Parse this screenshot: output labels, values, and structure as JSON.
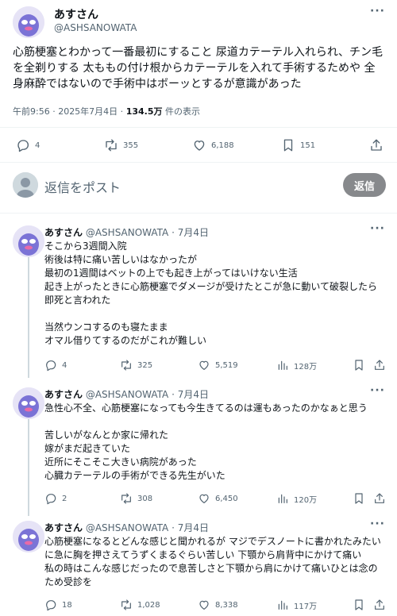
{
  "main_post": {
    "author_name": "あすさん",
    "author_handle": "@ASHSANOWATA",
    "text": "心筋梗塞とわかって一番最初にすること 尿道カテーテル入れられ、チン毛を全剃りする 太ももの付け根からカテーテルを入れて手術するためや 全身麻酔ではないので手術中はボーッとするが意識があった",
    "timestamp": "午前9:56 · 2025年7月4日 · ",
    "views_count": "134.5万",
    "views_label": " 件の表示",
    "replies": "4",
    "reposts": "355",
    "likes": "6,188",
    "bookmarks": "151",
    "icons": [
      "reply-icon",
      "repost-icon",
      "like-icon",
      "bookmark-icon",
      "share-icon"
    ]
  },
  "compose": {
    "placeholder": "返信をポスト",
    "button_label": "返信"
  },
  "replies": [
    {
      "author_name": "あすさん",
      "author_handle": "@ASHSANOWATA",
      "date": "7月4日",
      "text": "そこから3週間入院\n術後は特に痛い苦しいはなかったが\n最初の1週間はベットの上でも起き上がってはいけない生活\n起き上がったときに心筋梗塞でダメージが受けたとこが急に動いて破裂したら即死と言われた\n\n当然ウンコするのも寝たまま\nオマル借りてするのだがこれが難しい",
      "replies": "4",
      "reposts": "325",
      "likes": "5,519",
      "views": "128万"
    },
    {
      "author_name": "あすさん",
      "author_handle": "@ASHSANOWATA",
      "date": "7月4日",
      "text": "急性心不全、心筋梗塞になっても今生きてるのは運もあったのかなぁと思う\n\n苦しいがなんとか家に帰れた\n 嫁がまだ起きていた\n 近所にそこそこ大きい病院があった\n 心臓カテーテルの手術ができる先生がいた",
      "replies": "2",
      "reposts": "308",
      "likes": "6,450",
      "views": "120万"
    },
    {
      "author_name": "あすさん",
      "author_handle": "@ASHSANOWATA",
      "date": "7月4日",
      "text": "心筋梗塞になるとどんな感じと聞かれるが マジでデスノートに書かれたみたいに急に胸を押さえてうずくまるぐらい苦しい 下顎から肩背中にかけて痛い\n私の時はこんな感じだったので息苦しさと下顎から肩にかけて痛いひとは念のため受診を",
      "replies": "18",
      "reposts": "1,028",
      "likes": "8,338",
      "views": "117万"
    }
  ],
  "separator": " · ",
  "more_glyph": "···",
  "colors": {
    "text": "#0f1419",
    "secondary": "#536471",
    "divider": "#eff3f4",
    "reply_button": "#87898c"
  }
}
